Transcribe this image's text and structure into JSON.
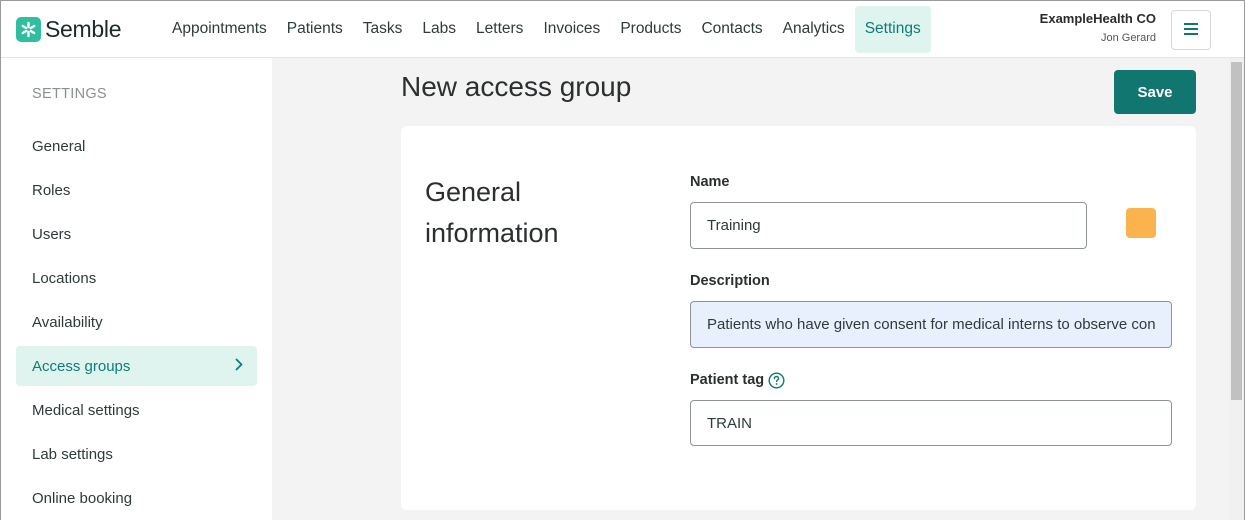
{
  "brand": {
    "name": "Semble",
    "color": "#2fbf9f",
    "logo_icon": "asterisk-icon"
  },
  "nav": {
    "items": [
      {
        "label": "Appointments"
      },
      {
        "label": "Patients"
      },
      {
        "label": "Tasks"
      },
      {
        "label": "Labs"
      },
      {
        "label": "Letters"
      },
      {
        "label": "Invoices"
      },
      {
        "label": "Products"
      },
      {
        "label": "Contacts"
      },
      {
        "label": "Analytics"
      },
      {
        "label": "Settings",
        "active": true
      }
    ]
  },
  "account": {
    "org": "ExampleHealth CO",
    "user": "Jon Gerard",
    "menu_icon": "hamburger-menu-icon"
  },
  "sidebar": {
    "heading": "SETTINGS",
    "items": [
      {
        "label": "General"
      },
      {
        "label": "Roles"
      },
      {
        "label": "Users"
      },
      {
        "label": "Locations"
      },
      {
        "label": "Availability"
      },
      {
        "label": "Access groups",
        "active": true
      },
      {
        "label": "Medical settings"
      },
      {
        "label": "Lab settings"
      },
      {
        "label": "Online booking"
      }
    ]
  },
  "page": {
    "title": "New access group",
    "save_label": "Save"
  },
  "form": {
    "section_title": "General information",
    "name_label": "Name",
    "name_value": "Training",
    "group_color": "#fbb44d",
    "description_label": "Description",
    "description_value": "Patients who have given consent for medical interns to observe con",
    "patient_tag_label": "Patient tag",
    "patient_tag_value": "TRAIN",
    "help_icon": "question-circle-icon"
  },
  "colors": {
    "accent": "#10766f",
    "accent_light": "#dff4ee",
    "accent_text": "#0e7d76"
  }
}
